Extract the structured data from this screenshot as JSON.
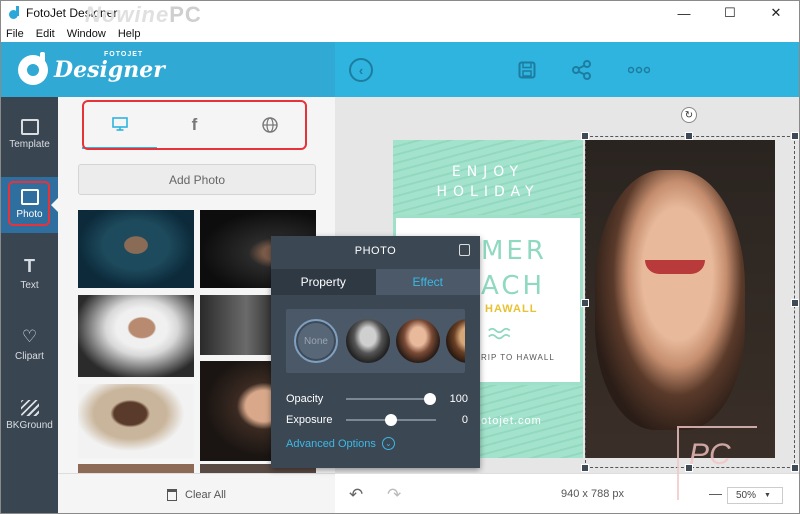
{
  "window": {
    "title": "FotoJet Designer",
    "watermark_word": "Nowine",
    "watermark_pc": "PC"
  },
  "window_controls": {
    "minimize": "—",
    "maximize": "☐",
    "close": "✕"
  },
  "menu": [
    "File",
    "Edit",
    "Window",
    "Help"
  ],
  "logo": {
    "main": "Designer",
    "small": "FOTOJET"
  },
  "colors": {
    "header": "#2eb4de",
    "sidebar": "#3a4552",
    "accent": "#2eb4de",
    "highlight": "#e8323a",
    "popup": "#3c4754"
  },
  "sidebar": {
    "items": [
      {
        "label": "Template",
        "icon": "template-icon"
      },
      {
        "label": "Photo",
        "icon": "photo-icon",
        "active": true
      },
      {
        "label": "Text",
        "icon": "text-icon"
      },
      {
        "label": "Clipart",
        "icon": "heart-icon"
      },
      {
        "label": "BKGround",
        "icon": "background-icon"
      }
    ]
  },
  "panel": {
    "tabs": [
      {
        "icon": "monitor-icon",
        "glyph": "🖵",
        "active": true
      },
      {
        "icon": "facebook-icon",
        "glyph": "f"
      },
      {
        "icon": "globe-icon",
        "glyph": "⊕"
      }
    ],
    "add_photo": "Add Photo",
    "clear_all": "Clear All"
  },
  "design": {
    "enjoy_line1": "ENJOY",
    "enjoy_line2": "HOLIDAY",
    "big_line1": "MER",
    "big_line2": "ACH",
    "hawaii": "HAWALL",
    "trip": "RIP TO HAWALL",
    "url": "fotojet.com"
  },
  "popup": {
    "title": "PHOTO",
    "tabs": [
      {
        "label": "Property"
      },
      {
        "label": "Effect",
        "active": true
      }
    ],
    "filter_none": "None",
    "opacity_label": "Opacity",
    "opacity_value": "100",
    "opacity_level": 1.0,
    "exposure_label": "Exposure",
    "exposure_value": "0",
    "exposure_level": 0.5,
    "advanced": "Advanced Options"
  },
  "bottom": {
    "dimensions": "940 x 788 px",
    "zoom": "50%",
    "zoom_minus": "—"
  }
}
